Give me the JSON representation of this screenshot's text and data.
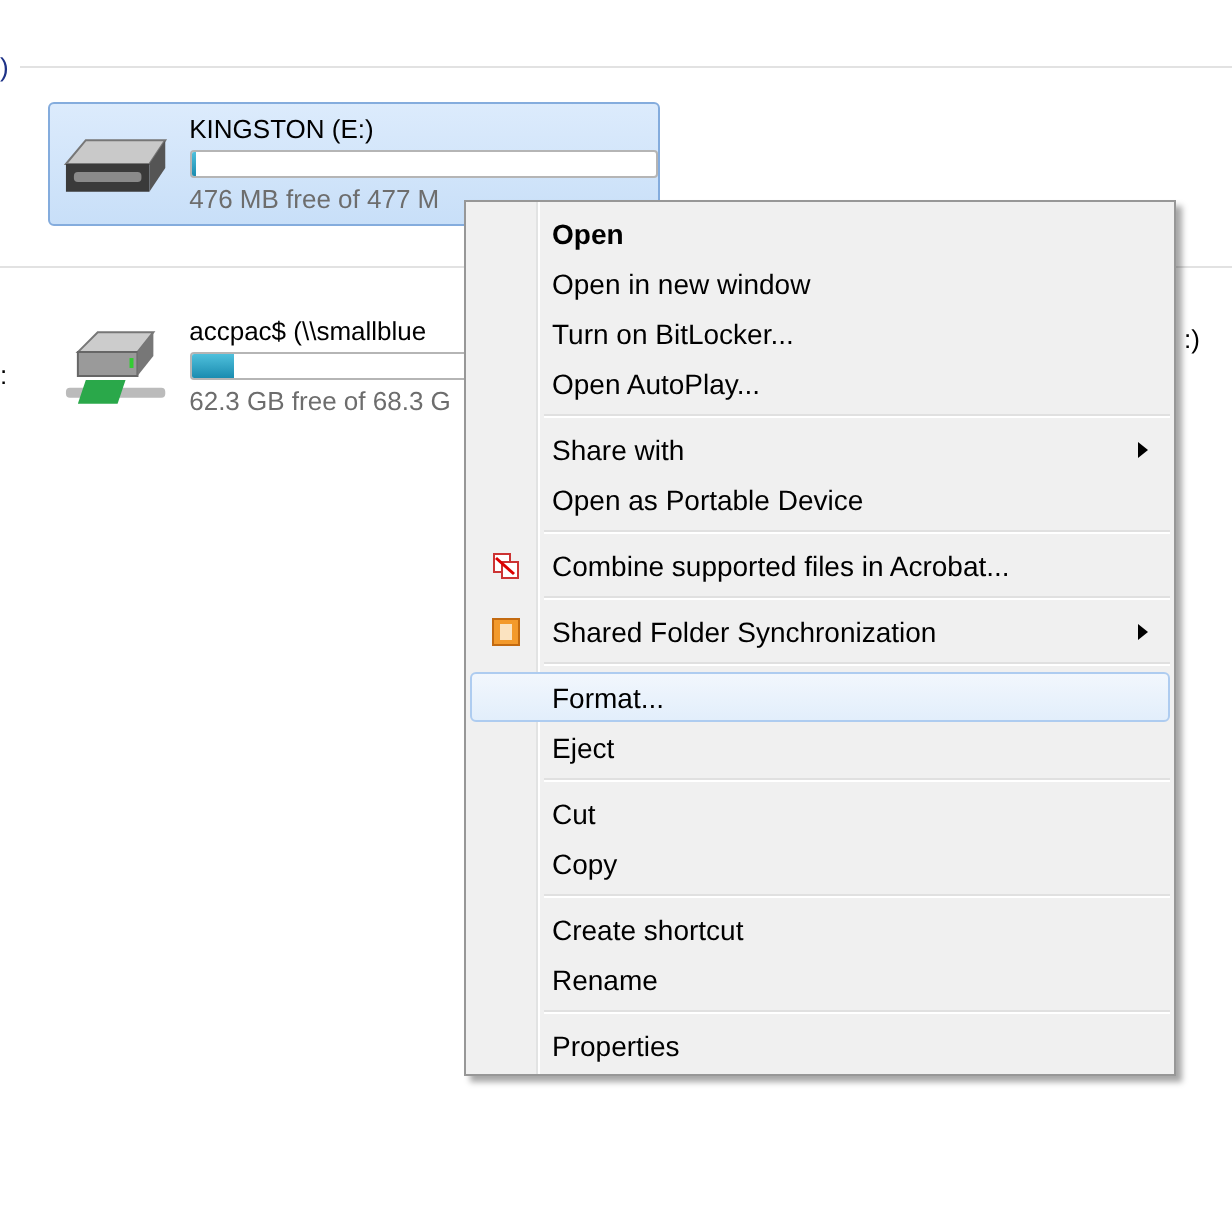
{
  "section_header": ")",
  "drives": [
    {
      "kind": "removable",
      "name": "KINGSTON (E:)",
      "free": "476 MB free of 477 M",
      "level": 0.01,
      "selected": true
    },
    {
      "kind": "network",
      "name": "accpac$ (\\\\smallblue",
      "free": "62.3 GB free of 68.3 G",
      "level": 0.09,
      "selected": false
    }
  ],
  "partial_left_label": ":",
  "partial_right_label": ":)",
  "context_menu": {
    "groups": [
      [
        {
          "label": "Open",
          "bold": true,
          "submenu": false,
          "selected": false
        },
        {
          "label": "Open in new window",
          "bold": false,
          "submenu": false,
          "selected": false
        },
        {
          "label": "Turn on BitLocker...",
          "bold": false,
          "submenu": false,
          "selected": false
        },
        {
          "label": "Open AutoPlay...",
          "bold": false,
          "submenu": false,
          "selected": false
        }
      ],
      [
        {
          "label": "Share with",
          "bold": false,
          "submenu": true,
          "selected": false
        },
        {
          "label": "Open as Portable Device",
          "bold": false,
          "submenu": false,
          "selected": false
        }
      ],
      [
        {
          "label": "Combine supported files in Acrobat...",
          "bold": false,
          "submenu": false,
          "selected": false,
          "kind": "acrobat"
        }
      ],
      [
        {
          "label": "Shared Folder Synchronization",
          "bold": false,
          "submenu": true,
          "selected": false,
          "kind": "sync"
        }
      ],
      [
        {
          "label": "Format...",
          "bold": false,
          "submenu": false,
          "selected": true
        },
        {
          "label": "Eject",
          "bold": false,
          "submenu": false,
          "selected": false
        }
      ],
      [
        {
          "label": "Cut",
          "bold": false,
          "submenu": false,
          "selected": false
        },
        {
          "label": "Copy",
          "bold": false,
          "submenu": false,
          "selected": false
        }
      ],
      [
        {
          "label": "Create shortcut",
          "bold": false,
          "submenu": false,
          "selected": false
        },
        {
          "label": "Rename",
          "bold": false,
          "submenu": false,
          "selected": false
        }
      ],
      [
        {
          "label": "Properties",
          "bold": false,
          "submenu": false,
          "selected": false
        }
      ]
    ]
  }
}
